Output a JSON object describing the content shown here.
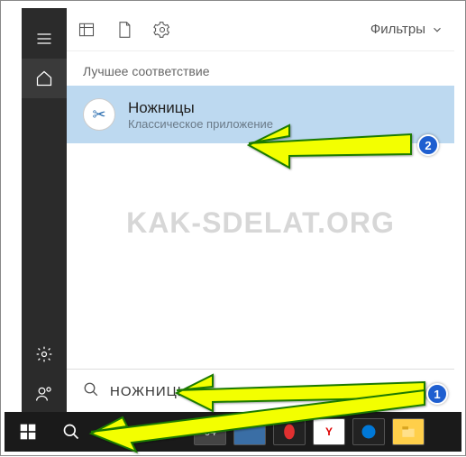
{
  "top_bar": {
    "filters_label": "Фильтры"
  },
  "section": {
    "best_match": "Лучшее соответствие"
  },
  "result": {
    "title": "Ножницы",
    "subtitle": "Классическое приложение",
    "icon_glyph": "✂"
  },
  "search": {
    "value": "НОЖНИЦЫ"
  },
  "watermark": "KAK-SDELAT.ORG",
  "annotations": {
    "badge1": "1",
    "badge2": "2"
  }
}
